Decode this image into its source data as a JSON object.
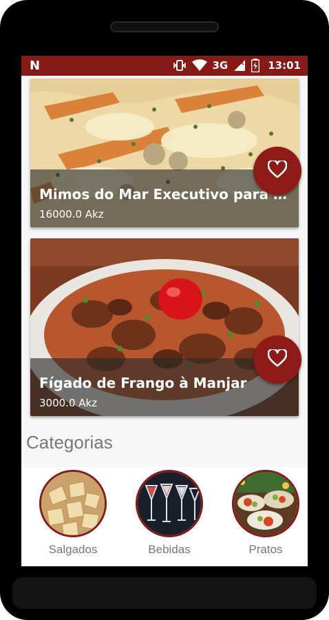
{
  "status_bar": {
    "left_icon": "N",
    "network": "3G",
    "time": "13:01",
    "color": "#861a17"
  },
  "dishes": [
    {
      "title": "Mimos do Mar Executivo para d...",
      "price": "16000.0 Akz",
      "favorite_icon": "heart-outline-icon"
    },
    {
      "title": "Fígado de Frango à Manjar",
      "price": "3000.0 Akz",
      "favorite_icon": "heart-outline-icon"
    }
  ],
  "categories_section": {
    "title": "Categorias",
    "items": [
      {
        "label": "Salgados"
      },
      {
        "label": "Bebidas"
      },
      {
        "label": "Pratos"
      }
    ]
  },
  "colors": {
    "accent": "#861a17",
    "fav_button": "#8e1b18"
  }
}
